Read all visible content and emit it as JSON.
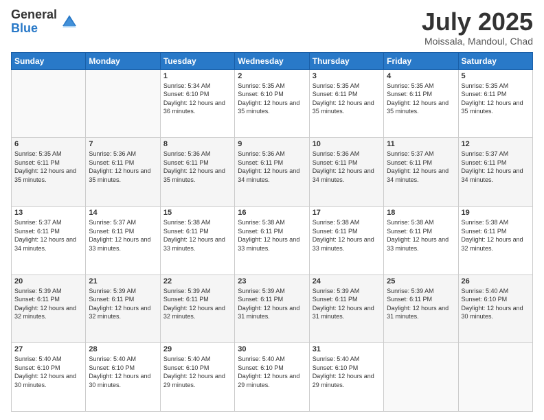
{
  "logo": {
    "general": "General",
    "blue": "Blue"
  },
  "header": {
    "month": "July 2025",
    "location": "Moissala, Mandoul, Chad"
  },
  "weekdays": [
    "Sunday",
    "Monday",
    "Tuesday",
    "Wednesday",
    "Thursday",
    "Friday",
    "Saturday"
  ],
  "weeks": [
    [
      {
        "day": "",
        "sunrise": "",
        "sunset": "",
        "daylight": ""
      },
      {
        "day": "",
        "sunrise": "",
        "sunset": "",
        "daylight": ""
      },
      {
        "day": "1",
        "sunrise": "Sunrise: 5:34 AM",
        "sunset": "Sunset: 6:10 PM",
        "daylight": "Daylight: 12 hours and 36 minutes."
      },
      {
        "day": "2",
        "sunrise": "Sunrise: 5:35 AM",
        "sunset": "Sunset: 6:10 PM",
        "daylight": "Daylight: 12 hours and 35 minutes."
      },
      {
        "day": "3",
        "sunrise": "Sunrise: 5:35 AM",
        "sunset": "Sunset: 6:11 PM",
        "daylight": "Daylight: 12 hours and 35 minutes."
      },
      {
        "day": "4",
        "sunrise": "Sunrise: 5:35 AM",
        "sunset": "Sunset: 6:11 PM",
        "daylight": "Daylight: 12 hours and 35 minutes."
      },
      {
        "day": "5",
        "sunrise": "Sunrise: 5:35 AM",
        "sunset": "Sunset: 6:11 PM",
        "daylight": "Daylight: 12 hours and 35 minutes."
      }
    ],
    [
      {
        "day": "6",
        "sunrise": "Sunrise: 5:35 AM",
        "sunset": "Sunset: 6:11 PM",
        "daylight": "Daylight: 12 hours and 35 minutes."
      },
      {
        "day": "7",
        "sunrise": "Sunrise: 5:36 AM",
        "sunset": "Sunset: 6:11 PM",
        "daylight": "Daylight: 12 hours and 35 minutes."
      },
      {
        "day": "8",
        "sunrise": "Sunrise: 5:36 AM",
        "sunset": "Sunset: 6:11 PM",
        "daylight": "Daylight: 12 hours and 35 minutes."
      },
      {
        "day": "9",
        "sunrise": "Sunrise: 5:36 AM",
        "sunset": "Sunset: 6:11 PM",
        "daylight": "Daylight: 12 hours and 34 minutes."
      },
      {
        "day": "10",
        "sunrise": "Sunrise: 5:36 AM",
        "sunset": "Sunset: 6:11 PM",
        "daylight": "Daylight: 12 hours and 34 minutes."
      },
      {
        "day": "11",
        "sunrise": "Sunrise: 5:37 AM",
        "sunset": "Sunset: 6:11 PM",
        "daylight": "Daylight: 12 hours and 34 minutes."
      },
      {
        "day": "12",
        "sunrise": "Sunrise: 5:37 AM",
        "sunset": "Sunset: 6:11 PM",
        "daylight": "Daylight: 12 hours and 34 minutes."
      }
    ],
    [
      {
        "day": "13",
        "sunrise": "Sunrise: 5:37 AM",
        "sunset": "Sunset: 6:11 PM",
        "daylight": "Daylight: 12 hours and 34 minutes."
      },
      {
        "day": "14",
        "sunrise": "Sunrise: 5:37 AM",
        "sunset": "Sunset: 6:11 PM",
        "daylight": "Daylight: 12 hours and 33 minutes."
      },
      {
        "day": "15",
        "sunrise": "Sunrise: 5:38 AM",
        "sunset": "Sunset: 6:11 PM",
        "daylight": "Daylight: 12 hours and 33 minutes."
      },
      {
        "day": "16",
        "sunrise": "Sunrise: 5:38 AM",
        "sunset": "Sunset: 6:11 PM",
        "daylight": "Daylight: 12 hours and 33 minutes."
      },
      {
        "day": "17",
        "sunrise": "Sunrise: 5:38 AM",
        "sunset": "Sunset: 6:11 PM",
        "daylight": "Daylight: 12 hours and 33 minutes."
      },
      {
        "day": "18",
        "sunrise": "Sunrise: 5:38 AM",
        "sunset": "Sunset: 6:11 PM",
        "daylight": "Daylight: 12 hours and 33 minutes."
      },
      {
        "day": "19",
        "sunrise": "Sunrise: 5:38 AM",
        "sunset": "Sunset: 6:11 PM",
        "daylight": "Daylight: 12 hours and 32 minutes."
      }
    ],
    [
      {
        "day": "20",
        "sunrise": "Sunrise: 5:39 AM",
        "sunset": "Sunset: 6:11 PM",
        "daylight": "Daylight: 12 hours and 32 minutes."
      },
      {
        "day": "21",
        "sunrise": "Sunrise: 5:39 AM",
        "sunset": "Sunset: 6:11 PM",
        "daylight": "Daylight: 12 hours and 32 minutes."
      },
      {
        "day": "22",
        "sunrise": "Sunrise: 5:39 AM",
        "sunset": "Sunset: 6:11 PM",
        "daylight": "Daylight: 12 hours and 32 minutes."
      },
      {
        "day": "23",
        "sunrise": "Sunrise: 5:39 AM",
        "sunset": "Sunset: 6:11 PM",
        "daylight": "Daylight: 12 hours and 31 minutes."
      },
      {
        "day": "24",
        "sunrise": "Sunrise: 5:39 AM",
        "sunset": "Sunset: 6:11 PM",
        "daylight": "Daylight: 12 hours and 31 minutes."
      },
      {
        "day": "25",
        "sunrise": "Sunrise: 5:39 AM",
        "sunset": "Sunset: 6:11 PM",
        "daylight": "Daylight: 12 hours and 31 minutes."
      },
      {
        "day": "26",
        "sunrise": "Sunrise: 5:40 AM",
        "sunset": "Sunset: 6:10 PM",
        "daylight": "Daylight: 12 hours and 30 minutes."
      }
    ],
    [
      {
        "day": "27",
        "sunrise": "Sunrise: 5:40 AM",
        "sunset": "Sunset: 6:10 PM",
        "daylight": "Daylight: 12 hours and 30 minutes."
      },
      {
        "day": "28",
        "sunrise": "Sunrise: 5:40 AM",
        "sunset": "Sunset: 6:10 PM",
        "daylight": "Daylight: 12 hours and 30 minutes."
      },
      {
        "day": "29",
        "sunrise": "Sunrise: 5:40 AM",
        "sunset": "Sunset: 6:10 PM",
        "daylight": "Daylight: 12 hours and 29 minutes."
      },
      {
        "day": "30",
        "sunrise": "Sunrise: 5:40 AM",
        "sunset": "Sunset: 6:10 PM",
        "daylight": "Daylight: 12 hours and 29 minutes."
      },
      {
        "day": "31",
        "sunrise": "Sunrise: 5:40 AM",
        "sunset": "Sunset: 6:10 PM",
        "daylight": "Daylight: 12 hours and 29 minutes."
      },
      {
        "day": "",
        "sunrise": "",
        "sunset": "",
        "daylight": ""
      },
      {
        "day": "",
        "sunrise": "",
        "sunset": "",
        "daylight": ""
      }
    ]
  ]
}
